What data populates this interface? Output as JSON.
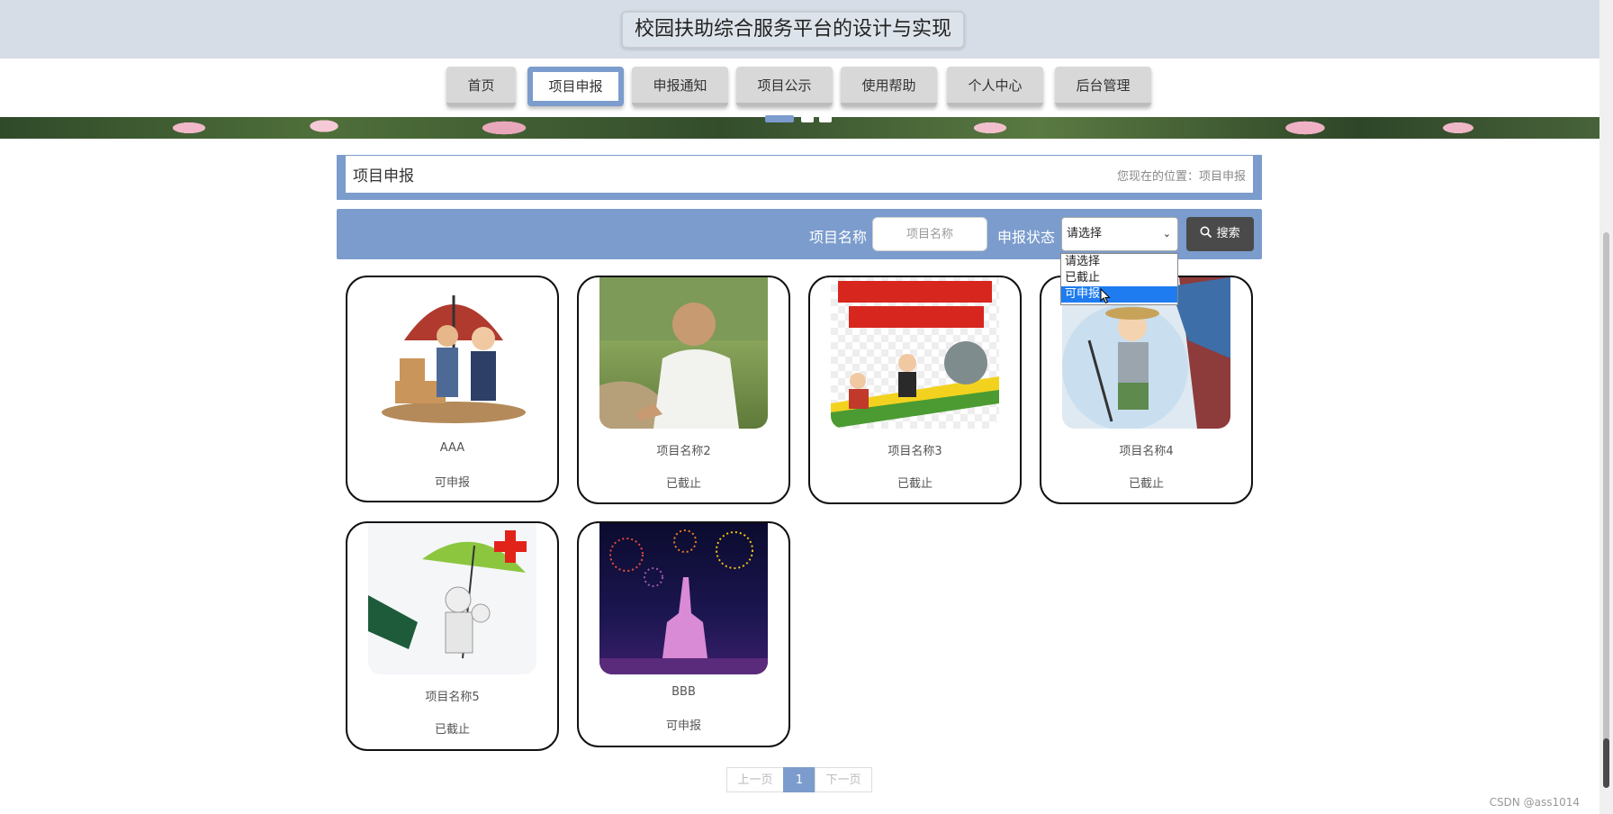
{
  "header": {
    "title": "校园扶助综合服务平台的设计与实现"
  },
  "nav": [
    {
      "label": "首页"
    },
    {
      "label": "项目申报"
    },
    {
      "label": "申报通知"
    },
    {
      "label": "项目公示"
    },
    {
      "label": "使用帮助"
    },
    {
      "label": "个人中心"
    },
    {
      "label": "后台管理"
    }
  ],
  "active_nav": "项目申报",
  "breadcrumb": {
    "title": "项目申报",
    "location": "您现在的位置：项目申报"
  },
  "search": {
    "name_label": "项目名称",
    "name_placeholder": "项目名称",
    "status_label": "申报状态",
    "status_value": "请选择",
    "button_label": "搜索",
    "options": [
      "请选择",
      "已截止",
      "可申报"
    ],
    "highlighted_option": "可申报"
  },
  "cards": [
    {
      "name": "AAA",
      "status": "可申报",
      "image": "poverty-alleviation-cartoon"
    },
    {
      "name": "项目名称2",
      "status": "已截止",
      "image": "elderly-man-photo"
    },
    {
      "name": "项目名称3",
      "status": "已截止",
      "image": "anti-poverty-poster"
    },
    {
      "name": "项目名称4",
      "status": "已截止",
      "image": "farmer-cartoon"
    },
    {
      "name": "项目名称5",
      "status": "已截止",
      "image": "medical-umbrella-cartoon"
    },
    {
      "name": "BBB",
      "status": "可申报",
      "image": "fireworks-castle-photo"
    }
  ],
  "pagination": {
    "prev": "上一页",
    "current": "1",
    "next": "下一页"
  },
  "watermark": "CSDN @ass1014",
  "colors": {
    "accent": "#7b9ccc",
    "header_bg": "#d6dde6",
    "search_button": "#4a4a4a",
    "select_highlight": "#1e7cf0"
  }
}
